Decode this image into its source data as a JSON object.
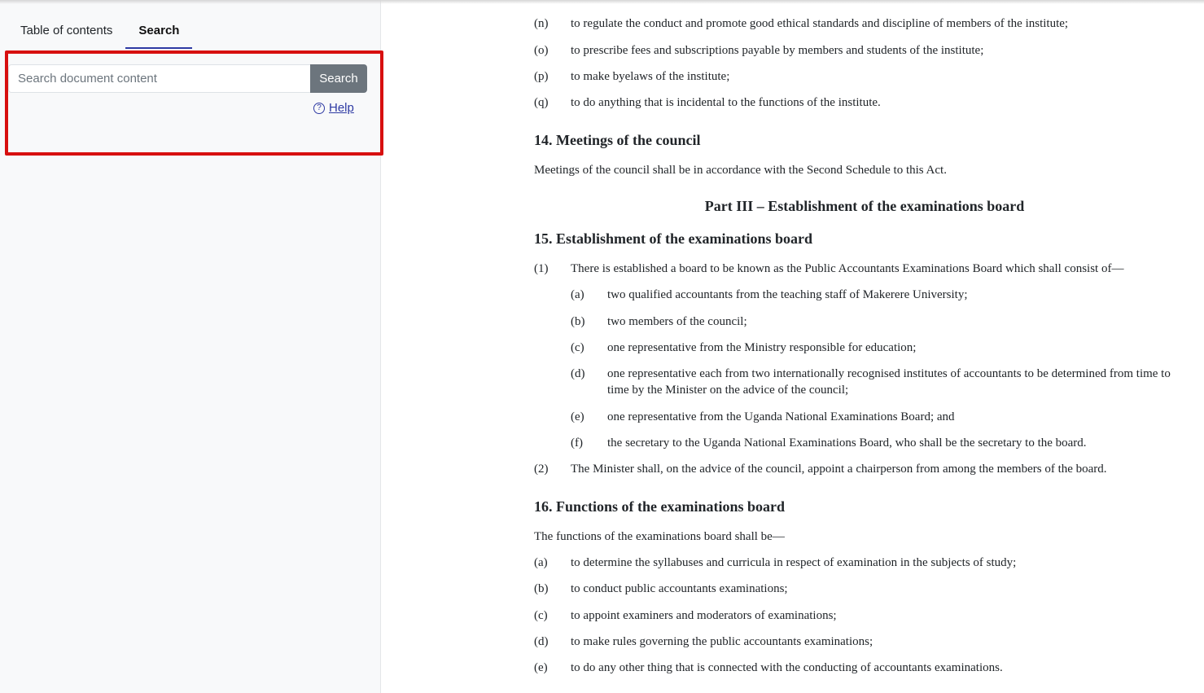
{
  "sidebar": {
    "tabs": [
      {
        "label": "Table of contents",
        "active": false
      },
      {
        "label": "Search",
        "active": true
      }
    ],
    "search": {
      "placeholder": "Search document content",
      "button_label": "Search",
      "help_icon": "?",
      "help_label": "Help"
    }
  },
  "colors": {
    "highlight_border": "#d70f0f",
    "search_button": "#6c757d",
    "link": "#2e3aa3"
  },
  "document": {
    "sec13_items": [
      {
        "num": "(n)",
        "text": "to regulate the conduct and promote good ethical standards and discipline of members of the institute;"
      },
      {
        "num": "(o)",
        "text": "to prescribe fees and subscriptions payable by members and students of the institute;"
      },
      {
        "num": "(p)",
        "text": "to make byelaws of the institute;"
      },
      {
        "num": "(q)",
        "text": "to do anything that is incidental to the functions of the institute."
      }
    ],
    "sec14": {
      "heading": "14. Meetings of the council",
      "text": "Meetings of the council shall be in accordance with the Second Schedule to this Act."
    },
    "part3_heading": "Part III – Establishment of the examinations board",
    "sec15": {
      "heading": "15. Establishment of the examinations board",
      "sub1": {
        "num": "(1)",
        "text": "There is established a board to be known as the Public Accountants Examinations Board which shall consist of—"
      },
      "items": [
        {
          "num": "(a)",
          "text": "two qualified accountants from the teaching staff of Makerere University;"
        },
        {
          "num": "(b)",
          "text": "two members of the council;"
        },
        {
          "num": "(c)",
          "text": "one representative from the Ministry responsible for education;"
        },
        {
          "num": "(d)",
          "text": "one representative each from two internationally recognised institutes of accountants to be determined from time to time by the Minister on the advice of the council;"
        },
        {
          "num": "(e)",
          "text": "one representative from the Uganda National Examinations Board; and"
        },
        {
          "num": "(f)",
          "text": "the secretary to the Uganda National Examinations Board, who shall be the secretary to the board."
        }
      ],
      "sub2": {
        "num": "(2)",
        "text": "The Minister shall, on the advice of the council, appoint a chairperson from among the members of the board."
      }
    },
    "sec16": {
      "heading": "16. Functions of the examinations board",
      "intro": "The functions of the examinations board shall be—",
      "items": [
        {
          "num": "(a)",
          "text": "to determine the syllabuses and curricula in respect of examination in the subjects of study;"
        },
        {
          "num": "(b)",
          "text": "to conduct public accountants examinations;"
        },
        {
          "num": "(c)",
          "text": "to appoint examiners and moderators of examinations;"
        },
        {
          "num": "(d)",
          "text": "to make rules governing the public accountants examinations;"
        },
        {
          "num": "(e)",
          "text": "to do any other thing that is connected with the conducting of accountants examinations."
        }
      ]
    }
  }
}
